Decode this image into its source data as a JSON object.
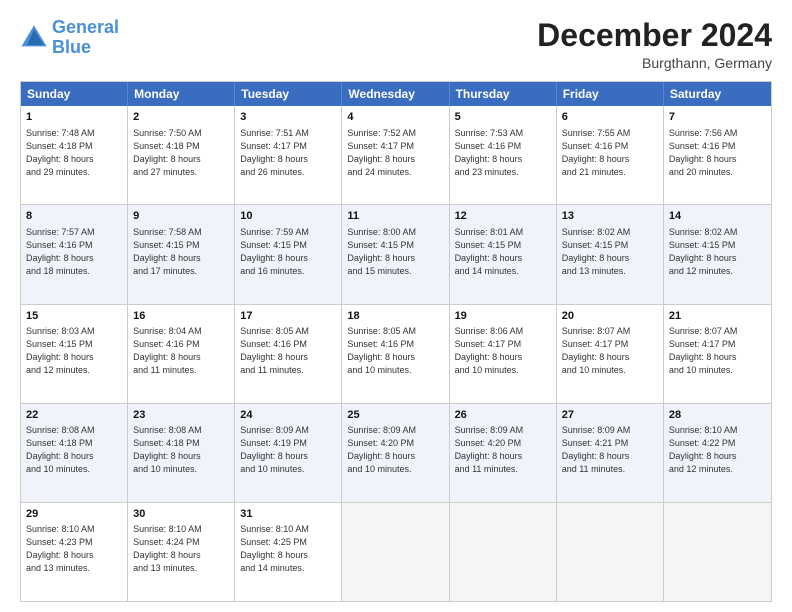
{
  "logo": {
    "line1": "General",
    "line2": "Blue"
  },
  "title": "December 2024",
  "subtitle": "Burgthann, Germany",
  "days_of_week": [
    "Sunday",
    "Monday",
    "Tuesday",
    "Wednesday",
    "Thursday",
    "Friday",
    "Saturday"
  ],
  "weeks": [
    [
      {
        "day": "1",
        "info": "Sunrise: 7:48 AM\nSunset: 4:18 PM\nDaylight: 8 hours\nand 29 minutes."
      },
      {
        "day": "2",
        "info": "Sunrise: 7:50 AM\nSunset: 4:18 PM\nDaylight: 8 hours\nand 27 minutes."
      },
      {
        "day": "3",
        "info": "Sunrise: 7:51 AM\nSunset: 4:17 PM\nDaylight: 8 hours\nand 26 minutes."
      },
      {
        "day": "4",
        "info": "Sunrise: 7:52 AM\nSunset: 4:17 PM\nDaylight: 8 hours\nand 24 minutes."
      },
      {
        "day": "5",
        "info": "Sunrise: 7:53 AM\nSunset: 4:16 PM\nDaylight: 8 hours\nand 23 minutes."
      },
      {
        "day": "6",
        "info": "Sunrise: 7:55 AM\nSunset: 4:16 PM\nDaylight: 8 hours\nand 21 minutes."
      },
      {
        "day": "7",
        "info": "Sunrise: 7:56 AM\nSunset: 4:16 PM\nDaylight: 8 hours\nand 20 minutes."
      }
    ],
    [
      {
        "day": "8",
        "info": "Sunrise: 7:57 AM\nSunset: 4:16 PM\nDaylight: 8 hours\nand 18 minutes."
      },
      {
        "day": "9",
        "info": "Sunrise: 7:58 AM\nSunset: 4:15 PM\nDaylight: 8 hours\nand 17 minutes."
      },
      {
        "day": "10",
        "info": "Sunrise: 7:59 AM\nSunset: 4:15 PM\nDaylight: 8 hours\nand 16 minutes."
      },
      {
        "day": "11",
        "info": "Sunrise: 8:00 AM\nSunset: 4:15 PM\nDaylight: 8 hours\nand 15 minutes."
      },
      {
        "day": "12",
        "info": "Sunrise: 8:01 AM\nSunset: 4:15 PM\nDaylight: 8 hours\nand 14 minutes."
      },
      {
        "day": "13",
        "info": "Sunrise: 8:02 AM\nSunset: 4:15 PM\nDaylight: 8 hours\nand 13 minutes."
      },
      {
        "day": "14",
        "info": "Sunrise: 8:02 AM\nSunset: 4:15 PM\nDaylight: 8 hours\nand 12 minutes."
      }
    ],
    [
      {
        "day": "15",
        "info": "Sunrise: 8:03 AM\nSunset: 4:15 PM\nDaylight: 8 hours\nand 12 minutes."
      },
      {
        "day": "16",
        "info": "Sunrise: 8:04 AM\nSunset: 4:16 PM\nDaylight: 8 hours\nand 11 minutes."
      },
      {
        "day": "17",
        "info": "Sunrise: 8:05 AM\nSunset: 4:16 PM\nDaylight: 8 hours\nand 11 minutes."
      },
      {
        "day": "18",
        "info": "Sunrise: 8:05 AM\nSunset: 4:16 PM\nDaylight: 8 hours\nand 10 minutes."
      },
      {
        "day": "19",
        "info": "Sunrise: 8:06 AM\nSunset: 4:17 PM\nDaylight: 8 hours\nand 10 minutes."
      },
      {
        "day": "20",
        "info": "Sunrise: 8:07 AM\nSunset: 4:17 PM\nDaylight: 8 hours\nand 10 minutes."
      },
      {
        "day": "21",
        "info": "Sunrise: 8:07 AM\nSunset: 4:17 PM\nDaylight: 8 hours\nand 10 minutes."
      }
    ],
    [
      {
        "day": "22",
        "info": "Sunrise: 8:08 AM\nSunset: 4:18 PM\nDaylight: 8 hours\nand 10 minutes."
      },
      {
        "day": "23",
        "info": "Sunrise: 8:08 AM\nSunset: 4:18 PM\nDaylight: 8 hours\nand 10 minutes."
      },
      {
        "day": "24",
        "info": "Sunrise: 8:09 AM\nSunset: 4:19 PM\nDaylight: 8 hours\nand 10 minutes."
      },
      {
        "day": "25",
        "info": "Sunrise: 8:09 AM\nSunset: 4:20 PM\nDaylight: 8 hours\nand 10 minutes."
      },
      {
        "day": "26",
        "info": "Sunrise: 8:09 AM\nSunset: 4:20 PM\nDaylight: 8 hours\nand 11 minutes."
      },
      {
        "day": "27",
        "info": "Sunrise: 8:09 AM\nSunset: 4:21 PM\nDaylight: 8 hours\nand 11 minutes."
      },
      {
        "day": "28",
        "info": "Sunrise: 8:10 AM\nSunset: 4:22 PM\nDaylight: 8 hours\nand 12 minutes."
      }
    ],
    [
      {
        "day": "29",
        "info": "Sunrise: 8:10 AM\nSunset: 4:23 PM\nDaylight: 8 hours\nand 13 minutes."
      },
      {
        "day": "30",
        "info": "Sunrise: 8:10 AM\nSunset: 4:24 PM\nDaylight: 8 hours\nand 13 minutes."
      },
      {
        "day": "31",
        "info": "Sunrise: 8:10 AM\nSunset: 4:25 PM\nDaylight: 8 hours\nand 14 minutes."
      },
      {
        "day": "",
        "info": ""
      },
      {
        "day": "",
        "info": ""
      },
      {
        "day": "",
        "info": ""
      },
      {
        "day": "",
        "info": ""
      }
    ]
  ]
}
